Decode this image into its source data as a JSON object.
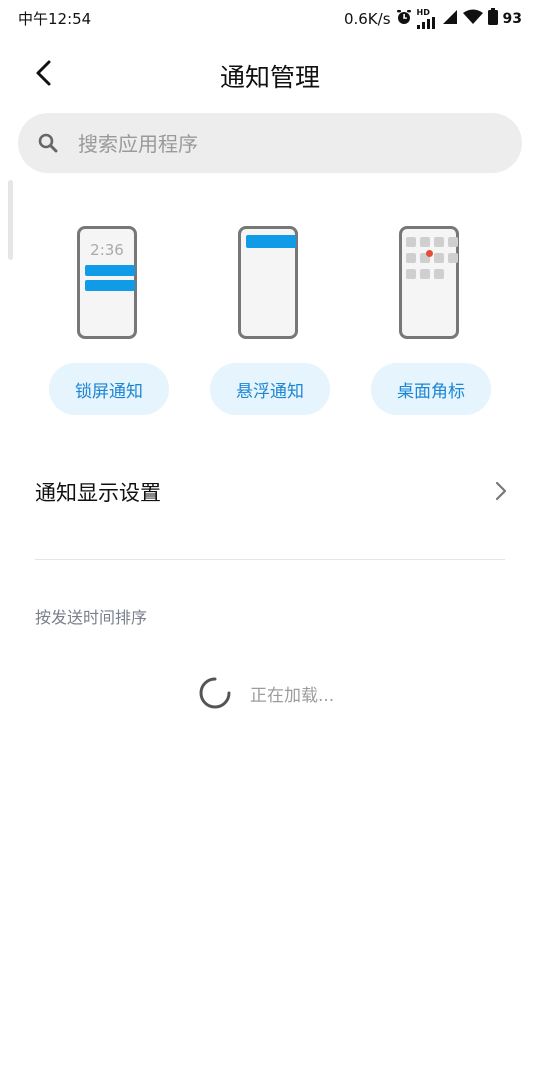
{
  "status_bar": {
    "time": "中午12:54",
    "net_speed": "0.6K/s",
    "hd_label": "HD",
    "battery": "93",
    "icons": [
      "alarm-icon",
      "signal-hd-icon",
      "signal-icon",
      "wifi-icon",
      "battery-icon"
    ]
  },
  "header": {
    "title": "通知管理",
    "back_icon": "chevron-left-icon"
  },
  "search": {
    "placeholder": "搜索应用程序",
    "value": "",
    "icon": "search-icon"
  },
  "cards": [
    {
      "label": "锁屏通知",
      "preview_time": "2:36"
    },
    {
      "label": "悬浮通知"
    },
    {
      "label": "桌面角标"
    }
  ],
  "settings_row": {
    "label": "通知显示设置",
    "chevron_icon": "chevron-right-icon"
  },
  "section": {
    "label": "按发送时间排序"
  },
  "loading": {
    "text": "正在加载..."
  },
  "colors": {
    "accent": "#0f9be6",
    "pill_bg": "#e5f4fd",
    "pill_text": "#1c86d4",
    "badge_red": "#e84a3c"
  }
}
